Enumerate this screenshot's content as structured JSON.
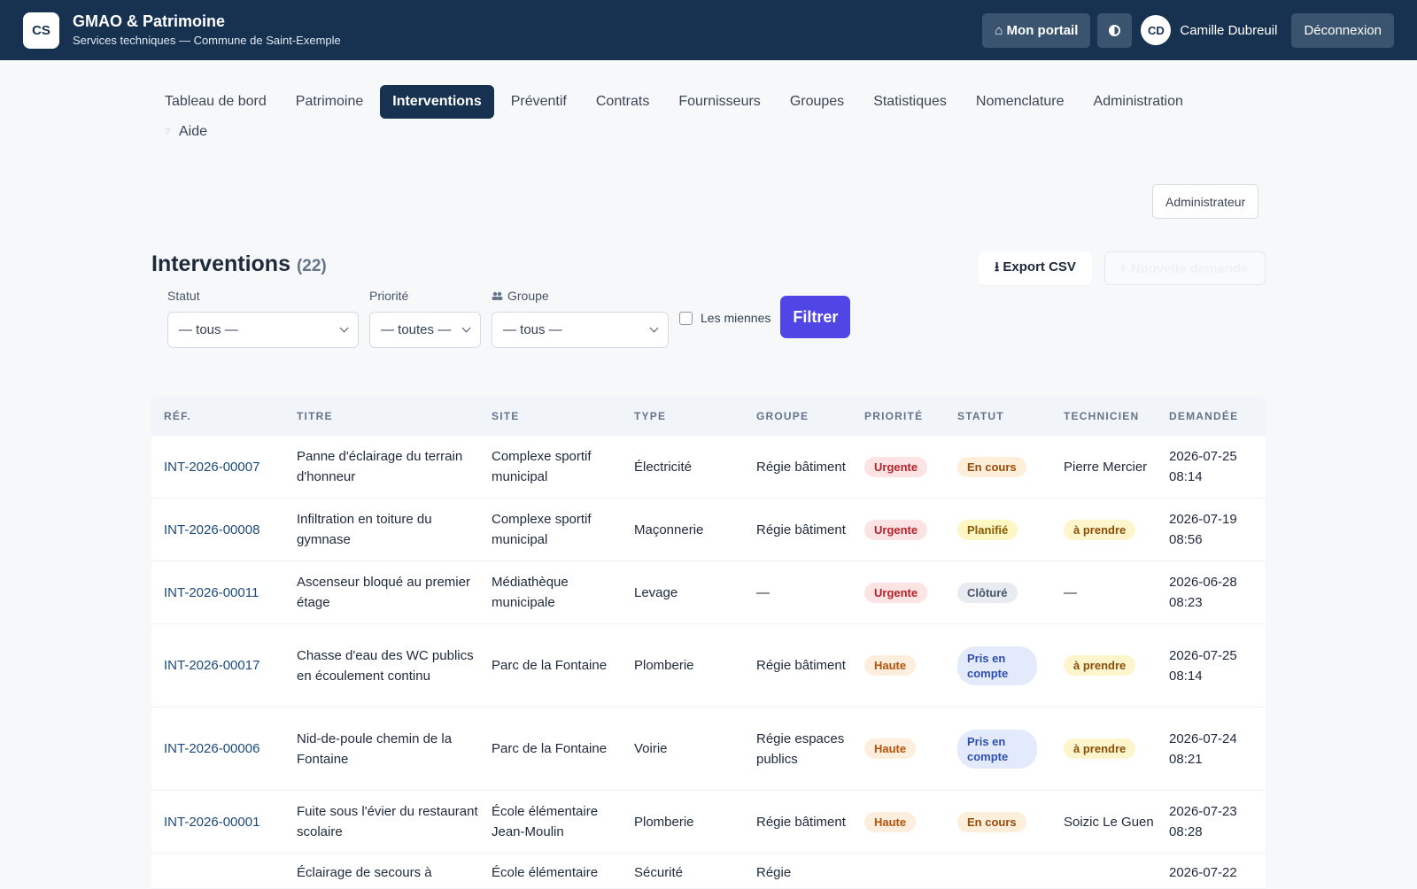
{
  "header": {
    "logo_text": "CS",
    "title": "GMAO & Patrimoine",
    "subtitle": "Services techniques — Commune de Saint-Exemple",
    "portal_label": "⌂ Mon portail",
    "theme_icon": "contrast-icon",
    "avatar_initials": "CD",
    "user_name": "Camille Dubreuil",
    "logout_label": "Déconnexion"
  },
  "nav": {
    "items": [
      "Tableau de bord",
      "Patrimoine",
      "Interventions",
      "Préventif",
      "Contrats",
      "Fournisseurs",
      "Groupes",
      "Statistiques",
      "Nomenclature",
      "Administration"
    ],
    "active": "Interventions",
    "help_mark": "?",
    "help_label": "Aide",
    "role_label": "Administrateur"
  },
  "page": {
    "title": "Interventions",
    "count": "(22)",
    "export_label": "⭳ Export CSV",
    "new_label": "+ Nouvelle demande"
  },
  "filters": {
    "status_label": "Statut",
    "status_value": "— tous —",
    "priority_label": "Priorité",
    "priority_value": "— toutes —",
    "group_label": "Groupe",
    "group_value": "— tous —",
    "mine_label": "Les miennes",
    "submit_label": "Filtrer"
  },
  "table": {
    "headers": [
      "RÉF.",
      "TITRE",
      "SITE",
      "TYPE",
      "GROUPE",
      "PRIORITÉ",
      "STATUT",
      "TECHNICIEN",
      "DEMANDÉE"
    ],
    "rows": [
      {
        "ref": "INT-2026-00007",
        "title": "Panne d'éclairage du terrain d'honneur",
        "site": "Complexe sportif municipal",
        "type": "Électricité",
        "group": "Régie bâtiment",
        "priority": "Urgente",
        "status": "En cours",
        "tech": "Pierre Mercier",
        "date": "2026-07-25 08:14"
      },
      {
        "ref": "INT-2026-00008",
        "title": "Infiltration en toiture du gymnase",
        "site": "Complexe sportif municipal",
        "type": "Maçonnerie",
        "group": "Régie bâtiment",
        "priority": "Urgente",
        "status": "Planifié",
        "tech": "à prendre",
        "date": "2026-07-19 08:56"
      },
      {
        "ref": "INT-2026-00011",
        "title": "Ascenseur bloqué au premier étage",
        "site": "Médiathèque municipale",
        "type": "Levage",
        "group": "—",
        "priority": "Urgente",
        "status": "Clôturé",
        "tech": "—",
        "date": "2026-06-28 08:23"
      },
      {
        "ref": "INT-2026-00017",
        "title": "Chasse d'eau des WC publics en écoulement continu",
        "site": "Parc de la Fontaine",
        "type": "Plomberie",
        "group": "Régie bâtiment",
        "priority": "Haute",
        "status": "Pris en compte",
        "tech": "à prendre",
        "date": "2026-07-25 08:14"
      },
      {
        "ref": "INT-2026-00006",
        "title": "Nid-de-poule chemin de la Fontaine",
        "site": "Parc de la Fontaine",
        "type": "Voirie",
        "group": "Régie espaces publics",
        "priority": "Haute",
        "status": "Pris en compte",
        "tech": "à prendre",
        "date": "2026-07-24 08:21"
      },
      {
        "ref": "INT-2026-00001",
        "title": "Fuite sous l'évier du restaurant scolaire",
        "site": "École élémentaire Jean-Moulin",
        "type": "Plomberie",
        "group": "Régie bâtiment",
        "priority": "Haute",
        "status": "En cours",
        "tech": "Soizic Le Guen",
        "date": "2026-07-23 08:28"
      },
      {
        "ref": "",
        "title": "Éclairage de secours à",
        "site": "École élémentaire",
        "type": "Sécurité",
        "group": "Régie",
        "priority": "",
        "status": "",
        "tech": "",
        "date": "2026-07-22"
      }
    ]
  }
}
